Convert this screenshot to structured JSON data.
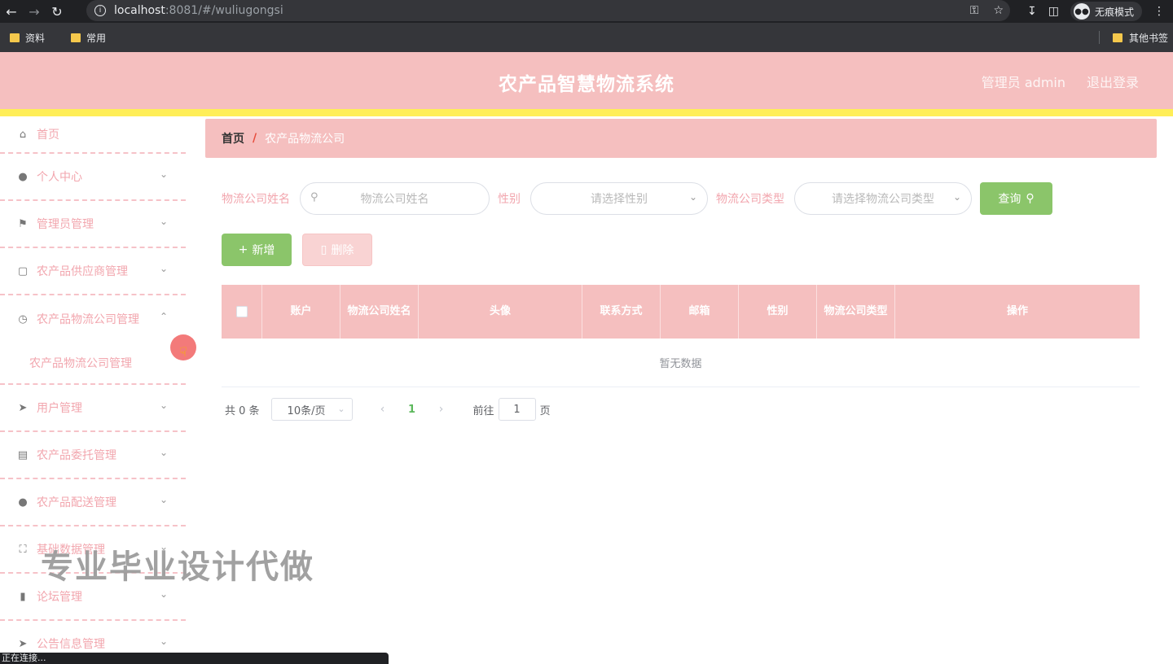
{
  "browser": {
    "url_host": "localhost",
    "url_rest": ":8081/#/wuliugongsi",
    "incognito_label": "无痕模式",
    "bookmarks": [
      "资料",
      "常用"
    ],
    "bookmark_other": "其他书签",
    "status_text": "正在连接..."
  },
  "header": {
    "title": "农产品智慧物流系统",
    "user": "管理员 admin",
    "logout": "退出登录"
  },
  "sidebar": {
    "items": [
      {
        "label": "首页",
        "icon": "home-icon"
      },
      {
        "label": "个人中心",
        "icon": "user-icon"
      },
      {
        "label": "管理员管理",
        "icon": "flag-icon"
      },
      {
        "label": "农产品供应商管理",
        "icon": "briefcase-icon"
      },
      {
        "label": "农产品物流公司管理",
        "icon": "clock-icon"
      },
      {
        "label": "用户管理",
        "icon": "send-icon"
      },
      {
        "label": "农产品委托管理",
        "icon": "chart-icon"
      },
      {
        "label": "农产品配送管理",
        "icon": "person-icon"
      },
      {
        "label": "基础数据管理",
        "icon": "fullscreen-icon"
      },
      {
        "label": "论坛管理",
        "icon": "ticket-icon"
      },
      {
        "label": "公告信息管理",
        "icon": "navigation-icon"
      }
    ],
    "submenu_label": "农产品物流公司管理"
  },
  "breadcrumb": {
    "home": "首页",
    "separator": "/",
    "current": "农产品物流公司"
  },
  "search": {
    "name_label": "物流公司姓名",
    "name_placeholder": "物流公司姓名",
    "gender_label": "性别",
    "gender_placeholder": "请选择性别",
    "type_label": "物流公司类型",
    "type_placeholder": "请选择物流公司类型",
    "query_button": "查询"
  },
  "actions": {
    "add": "新增",
    "delete": "删除"
  },
  "table": {
    "columns": [
      "账户",
      "物流公司姓名",
      "头像",
      "联系方式",
      "邮箱",
      "性别",
      "物流公司类型",
      "操作"
    ],
    "empty_text": "暂无数据"
  },
  "pagination": {
    "total_text": "共 0 条",
    "page_size": "10条/页",
    "current_page": "1",
    "goto_prefix": "前往",
    "goto_value": "1",
    "goto_suffix": "页"
  },
  "watermark": "专业毕业设计代做",
  "colors": {
    "header_bg": "#f5bfbf",
    "accent_yellow": "#ffee58",
    "button_green": "#8bc56a",
    "menu_text": "#f2a6ae"
  }
}
